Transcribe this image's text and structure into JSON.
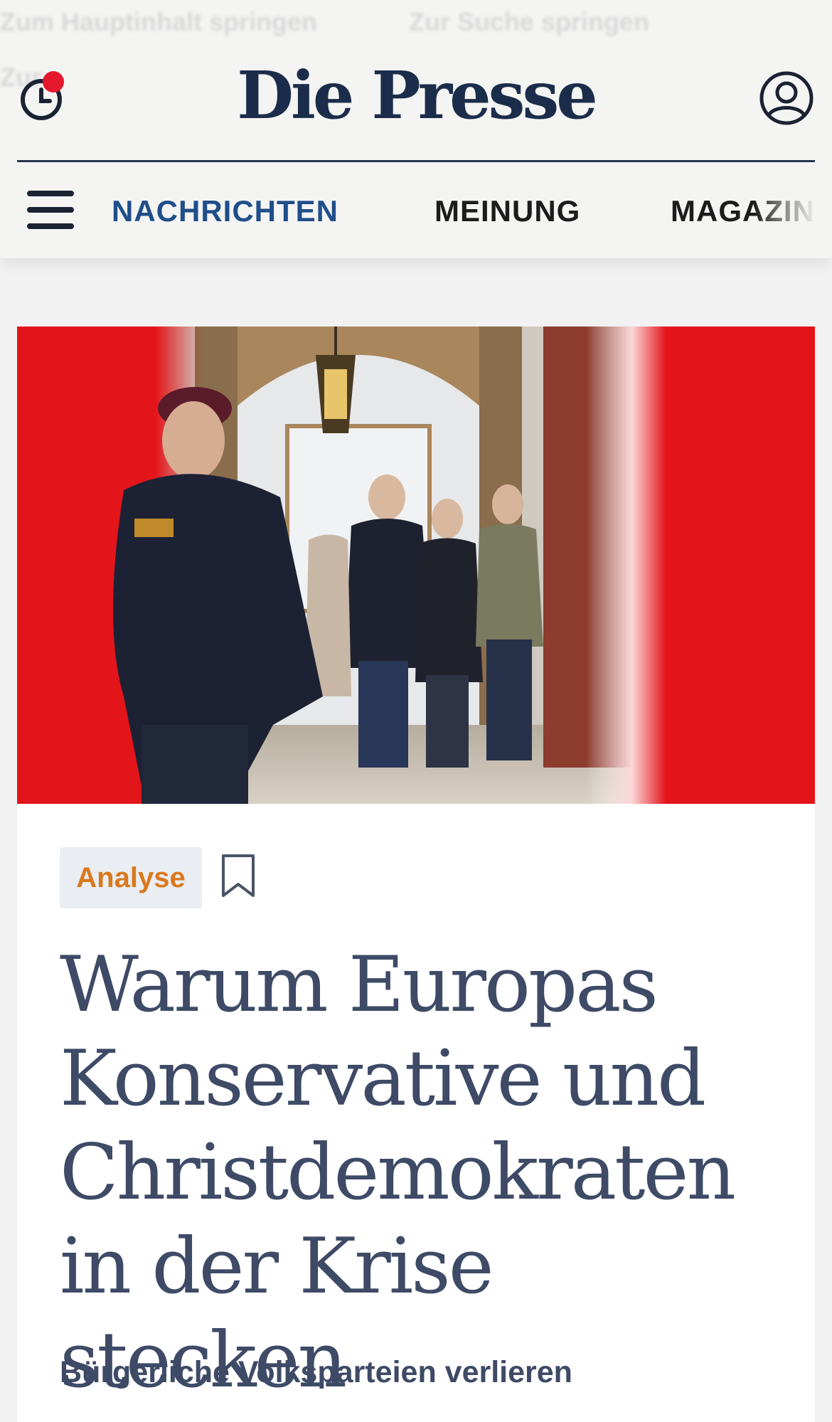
{
  "skip_links": {
    "main_content": "Zum Hauptinhalt springen",
    "search": "Zur Suche springen",
    "other": "Zur"
  },
  "header": {
    "logo": "Die Presse",
    "history_icon": "clock-icon",
    "notification_dot_color": "#e5172c",
    "account_icon": "user-circle-icon"
  },
  "nav": {
    "menu_icon": "hamburger-icon",
    "items": [
      {
        "label": "NACHRICHTEN",
        "active": true
      },
      {
        "label": "MEINUNG",
        "active": false
      },
      {
        "label": "MAGAZIN",
        "active": false
      }
    ]
  },
  "article": {
    "image_alt": "Polizist und Politiker verlassen ein Gebäude",
    "tag": "Analyse",
    "headline": "Warum Europas Konservative und Christdemokraten in der Krise stecken",
    "lead": "Bürgerliche Volksparteien verlieren"
  },
  "colors": {
    "brand": "#1c2d4b",
    "nav_active": "#1f4e8a",
    "tag_text": "#d9791e",
    "tag_bg": "#eaedf1",
    "headline": "#3e4a66"
  }
}
